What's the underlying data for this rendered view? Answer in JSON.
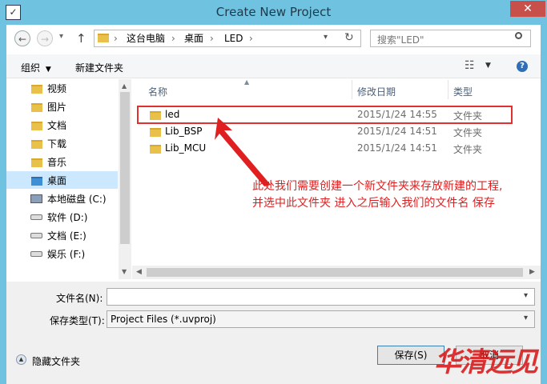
{
  "window": {
    "title": "Create New Project",
    "close_label": "✕"
  },
  "nav": {
    "back_glyph": "←",
    "forward_glyph": "→",
    "up_glyph": "↑",
    "refresh_glyph": "↻",
    "address_sep": "›",
    "breadcrumbs": [
      "这台电脑",
      "桌面",
      "LED"
    ],
    "search_placeholder": "搜索\"LED\""
  },
  "toolbar": {
    "organize": "组织",
    "new_folder": "新建文件夹"
  },
  "sidebar": {
    "items": [
      {
        "label": "视频"
      },
      {
        "label": "图片"
      },
      {
        "label": "文档"
      },
      {
        "label": "下载"
      },
      {
        "label": "音乐"
      },
      {
        "label": "桌面"
      },
      {
        "label": "本地磁盘 (C:)"
      },
      {
        "label": "软件 (D:)"
      },
      {
        "label": "文档 (E:)"
      },
      {
        "label": "娱乐 (F:)"
      }
    ]
  },
  "file_list": {
    "columns": [
      "名称",
      "修改日期",
      "类型"
    ],
    "rows": [
      {
        "name": "led",
        "date": "2015/1/24 14:55",
        "type": "文件夹"
      },
      {
        "name": "Lib_BSP",
        "date": "2015/1/24 14:51",
        "type": "文件夹"
      },
      {
        "name": "Lib_MCU",
        "date": "2015/1/24 14:51",
        "type": "文件夹"
      }
    ]
  },
  "annotation": {
    "line1": "此处我们需要创建一个新文件夹来存放新建的工程,",
    "line2": "并选中此文件夹 进入之后输入我们的文件名 保存",
    "color": "#e02020"
  },
  "form": {
    "filename_label": "文件名(N):",
    "filename_value": "",
    "filetype_label": "保存类型(T):",
    "filetype_value": "Project Files (*.uvproj)"
  },
  "footer": {
    "hide_folders": "隐藏文件夹",
    "save_button": "保存(S)",
    "cancel_button": "取消"
  },
  "watermark": {
    "text": "华清远见"
  }
}
